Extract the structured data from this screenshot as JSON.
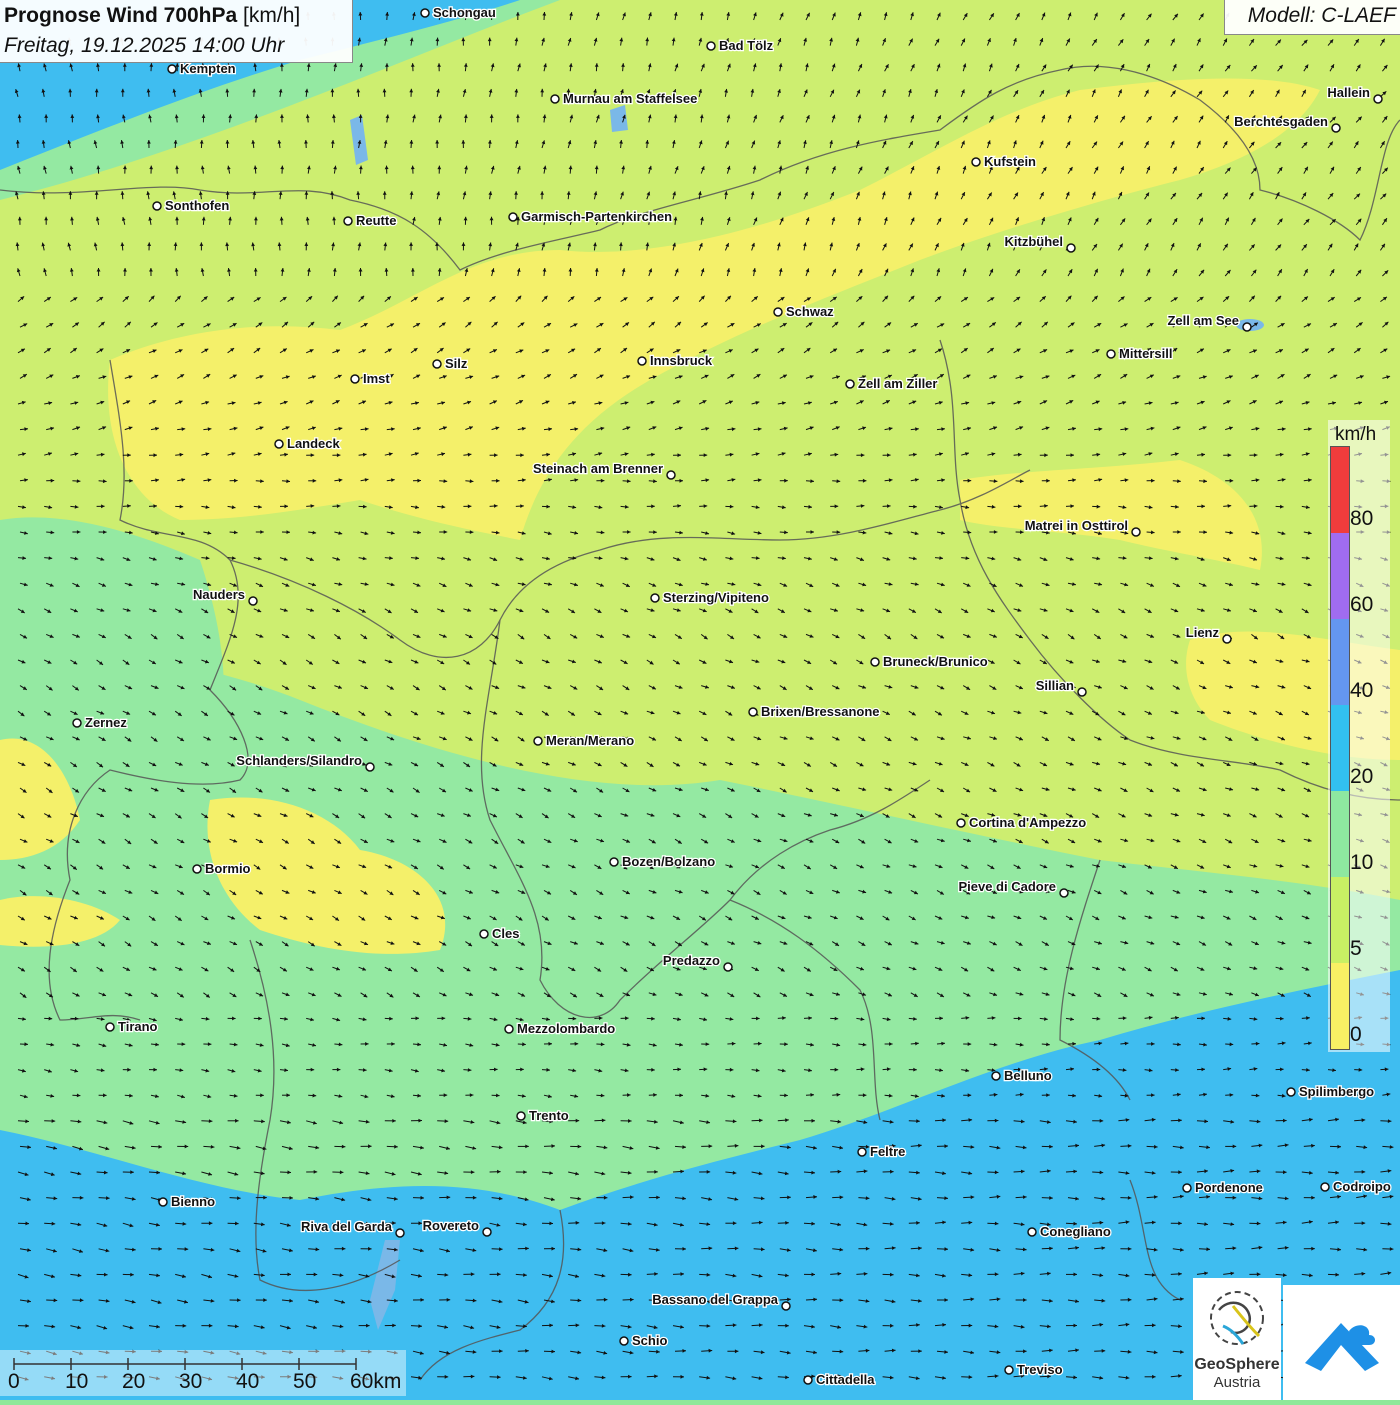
{
  "header": {
    "title_bold": "Prognose Wind 700hPa",
    "title_unit": "[km/h]",
    "valid_time": "Freitag, 19.12.2025 14:00 Uhr",
    "model": "Modell: C-LAEF"
  },
  "legend": {
    "unit": "km/h",
    "ticks": [
      "80",
      "60",
      "40",
      "20",
      "10",
      "5",
      "0"
    ],
    "colors": [
      "#f03c3c",
      "#a06cf0",
      "#6496f0",
      "#32c0f0",
      "#8ee8a0",
      "#c8f064",
      "#f8f064"
    ]
  },
  "scalebar": {
    "labels": [
      "0",
      "10",
      "20",
      "30",
      "40",
      "50",
      "60km"
    ]
  },
  "logos": {
    "geosphere_name": "GeoSphere",
    "geosphere_sub": "Austria"
  },
  "colors": {
    "speed_0_5": "#f4f06a",
    "speed_5_10": "#cdee70",
    "speed_10_20": "#94e9a2",
    "speed_20_40": "#3fbdf0",
    "water": "#7ab8e8",
    "border": "#555555"
  },
  "cities": [
    {
      "name": "Schongau"
    },
    {
      "name": "Bad Tölz"
    },
    {
      "name": "Kempten"
    },
    {
      "name": "Hallein"
    },
    {
      "name": "Murnau am Staffelsee"
    },
    {
      "name": "Berchtesgaden"
    },
    {
      "name": "Kufstein"
    },
    {
      "name": "Sonthofen"
    },
    {
      "name": "Reutte"
    },
    {
      "name": "Garmisch-Partenkirchen"
    },
    {
      "name": "Kitzbühel"
    },
    {
      "name": "Schwaz"
    },
    {
      "name": "Zell am See"
    },
    {
      "name": "Mittersill"
    },
    {
      "name": "Silz"
    },
    {
      "name": "Innsbruck"
    },
    {
      "name": "Imst"
    },
    {
      "name": "Zell am Ziller"
    },
    {
      "name": "Landeck"
    },
    {
      "name": "Steinach am Brenner"
    },
    {
      "name": "Matrei in Osttirol"
    },
    {
      "name": "Nauders"
    },
    {
      "name": "Sterzing/Vipiteno"
    },
    {
      "name": "Lienz"
    },
    {
      "name": "Bruneck/Brunico"
    },
    {
      "name": "Sillian"
    },
    {
      "name": "Brixen/Bressanone"
    },
    {
      "name": "Zernez"
    },
    {
      "name": "Meran/Merano"
    },
    {
      "name": "Schlanders/Silandro"
    },
    {
      "name": "Cortina d'Ampezzo"
    },
    {
      "name": "Bozen/Bolzano"
    },
    {
      "name": "Bormio"
    },
    {
      "name": "Pieve di Cadore"
    },
    {
      "name": "Cles"
    },
    {
      "name": "Predazzo"
    },
    {
      "name": "Tirano"
    },
    {
      "name": "Mezzolombardo"
    },
    {
      "name": "Belluno"
    },
    {
      "name": "Spilimbergo"
    },
    {
      "name": "Trento"
    },
    {
      "name": "Feltre"
    },
    {
      "name": "Pordenone"
    },
    {
      "name": "Codroipo"
    },
    {
      "name": "Bienno"
    },
    {
      "name": "Riva del Garda"
    },
    {
      "name": "Rovereto"
    },
    {
      "name": "Conegliano"
    },
    {
      "name": "Bassano del Grappa"
    },
    {
      "name": "Schio"
    },
    {
      "name": "Treviso"
    },
    {
      "name": "Cittadella"
    }
  ]
}
